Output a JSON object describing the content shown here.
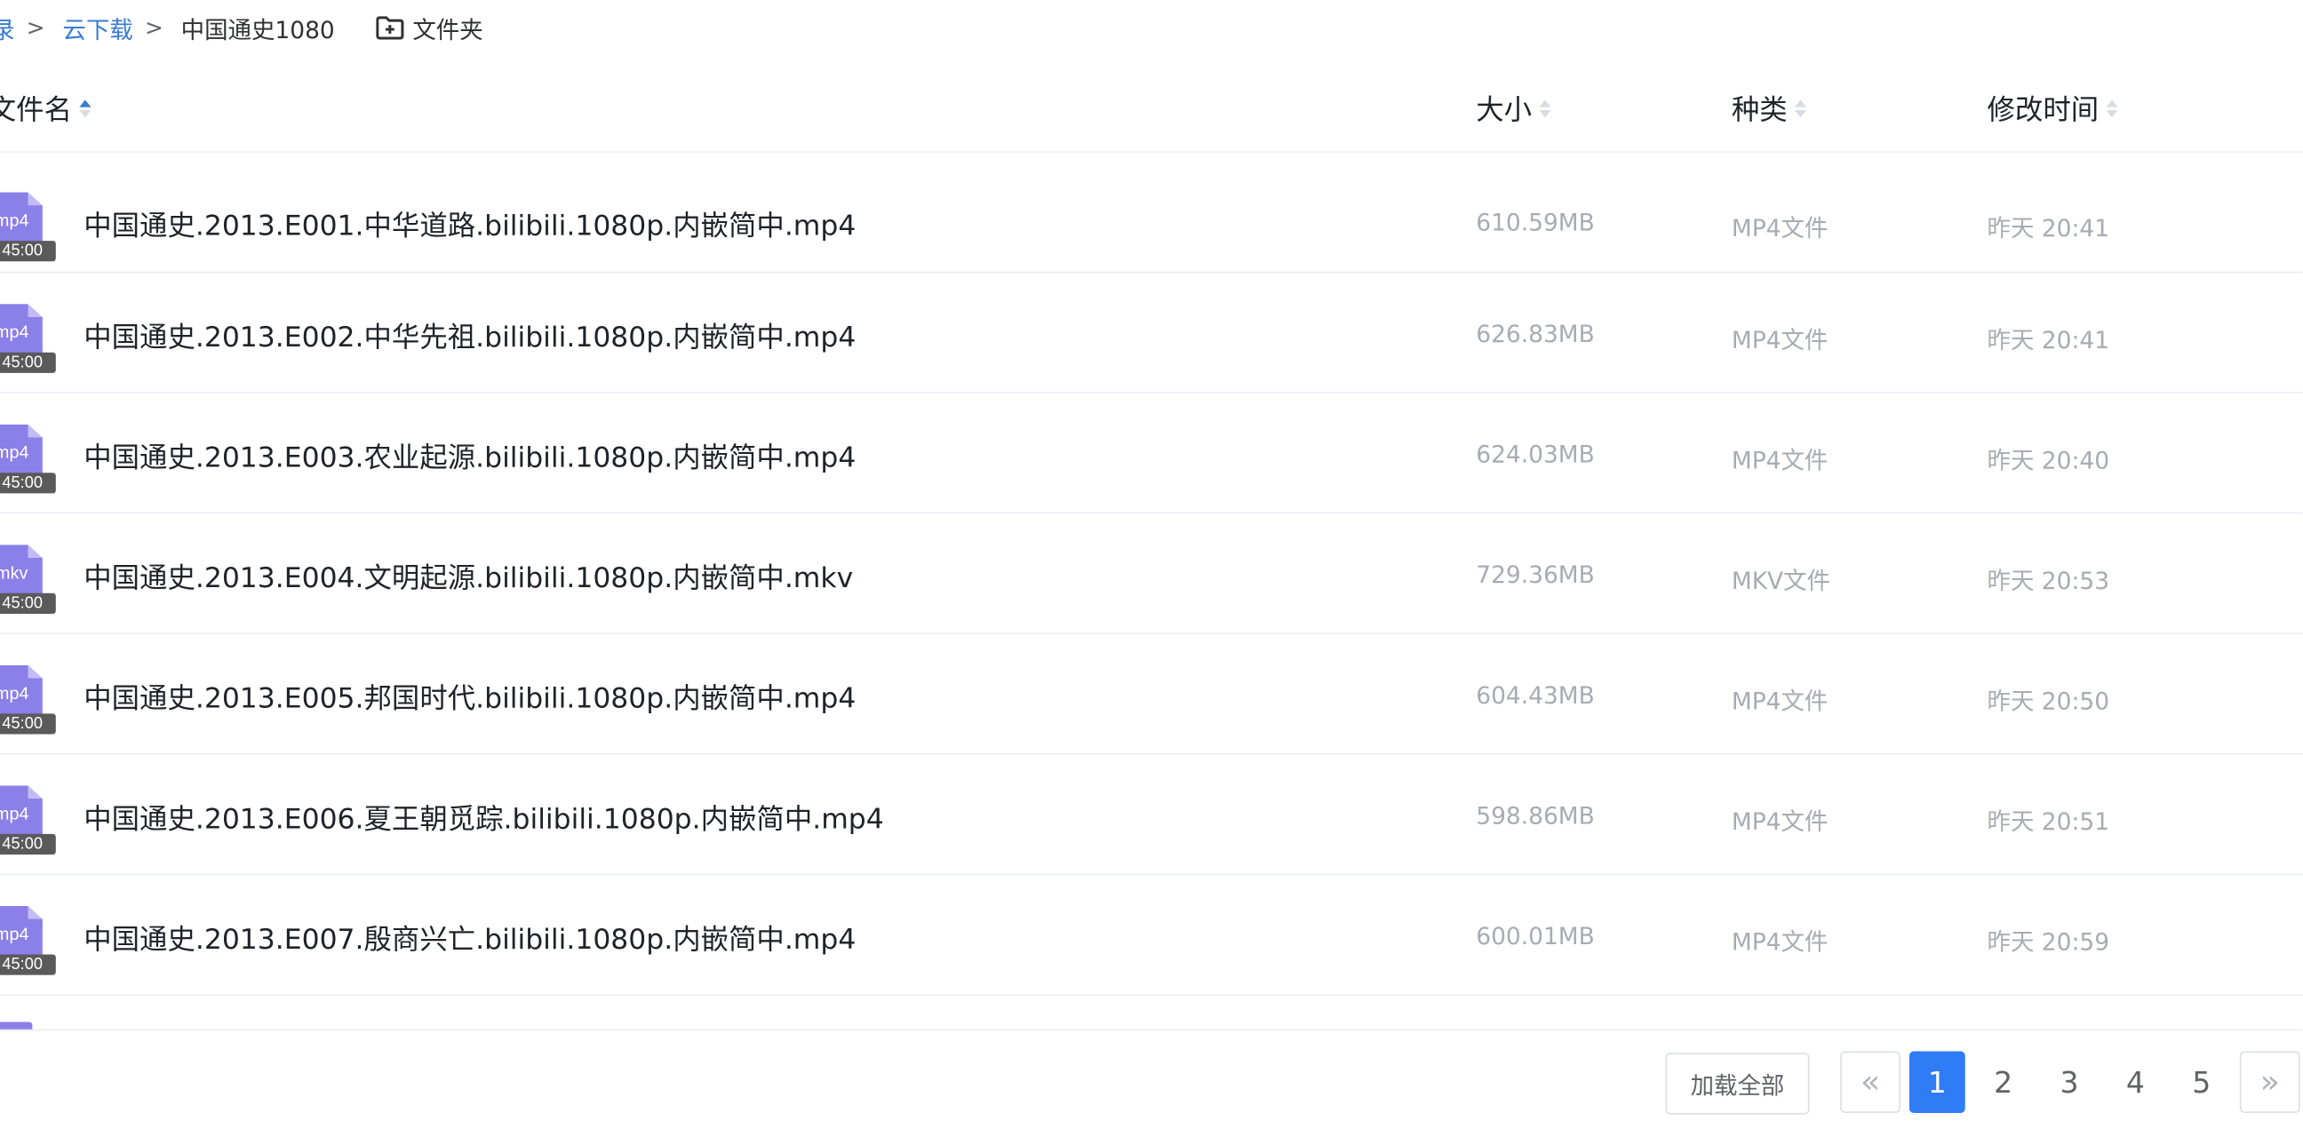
{
  "breadcrumb": {
    "items": [
      "录",
      "云下载",
      "中国通史1080"
    ],
    "new_folder_label": "文件夹"
  },
  "columns": {
    "name": "文件名",
    "size": "大小",
    "type": "种类",
    "modified": "修改时间"
  },
  "files": [
    {
      "ext": "mp4",
      "duration": "45:00",
      "name": "中国通史.2013.E001.中华道路.bilibili.1080p.内嵌简中.mp4",
      "size": "610.59MB",
      "type": "MP4文件",
      "modified": "昨天 20:41"
    },
    {
      "ext": "mp4",
      "duration": "45:00",
      "name": "中国通史.2013.E002.中华先祖.bilibili.1080p.内嵌简中.mp4",
      "size": "626.83MB",
      "type": "MP4文件",
      "modified": "昨天 20:41"
    },
    {
      "ext": "mp4",
      "duration": "45:00",
      "name": "中国通史.2013.E003.农业起源.bilibili.1080p.内嵌简中.mp4",
      "size": "624.03MB",
      "type": "MP4文件",
      "modified": "昨天 20:40"
    },
    {
      "ext": "mkv",
      "duration": "45:00",
      "name": "中国通史.2013.E004.文明起源.bilibili.1080p.内嵌简中.mkv",
      "size": "729.36MB",
      "type": "MKV文件",
      "modified": "昨天 20:53"
    },
    {
      "ext": "mp4",
      "duration": "45:00",
      "name": "中国通史.2013.E005.邦国时代.bilibili.1080p.内嵌简中.mp4",
      "size": "604.43MB",
      "type": "MP4文件",
      "modified": "昨天 20:50"
    },
    {
      "ext": "mp4",
      "duration": "45:00",
      "name": "中国通史.2013.E006.夏王朝觅踪.bilibili.1080p.内嵌简中.mp4",
      "size": "598.86MB",
      "type": "MP4文件",
      "modified": "昨天 20:51"
    },
    {
      "ext": "mp4",
      "duration": "45:00",
      "name": "中国通史.2013.E007.殷商兴亡.bilibili.1080p.内嵌简中.mp4",
      "size": "600.01MB",
      "type": "MP4文件",
      "modified": "昨天 20:59"
    }
  ],
  "pagination": {
    "load_all_label": "加载全部",
    "prev_label": "«",
    "next_label": "»",
    "pages": [
      "1",
      "2",
      "3",
      "4",
      "5"
    ],
    "current_page": "1"
  },
  "colors": {
    "accent": "#2f7cf6",
    "link": "#3a7bd5",
    "video_icon": "#8b7fe8"
  }
}
